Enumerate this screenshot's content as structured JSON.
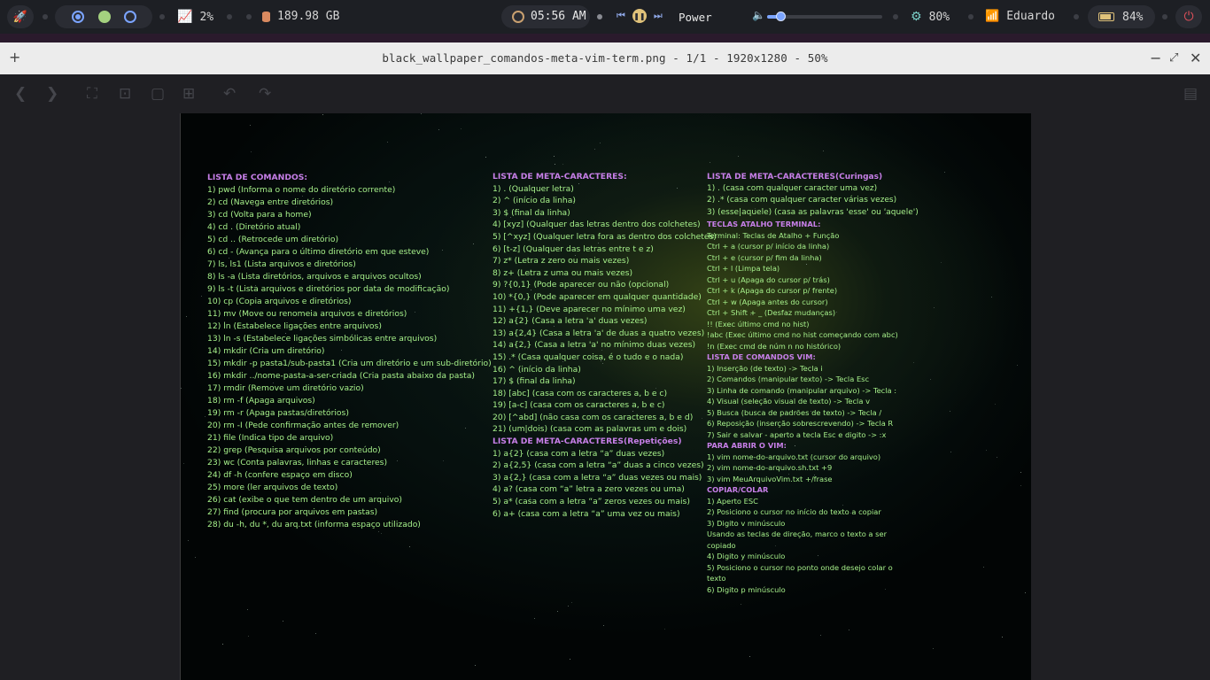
{
  "topbar": {
    "cpu": "2%",
    "disk": "189.98 GB",
    "time": "05:56 AM",
    "power_profile": "Power",
    "volume_level": 0.2,
    "brightness": "80%",
    "wifi": "Eduardo",
    "battery": "84%"
  },
  "window": {
    "title": "black_wallpaper_comandos-meta-vim-term.png - 1/1 - 1920x1280 - 50%",
    "add": "+",
    "minimize": "−",
    "restore": "⤢",
    "close": "✕"
  },
  "icons": {
    "launcher": "rocket-icon",
    "cpu": "chart-icon",
    "disk": "database-icon",
    "clock": "clock-icon",
    "volume": "speaker-icon",
    "brightness": "gear-icon",
    "wifi": "wifi-icon",
    "battery": "battery-icon",
    "power": "power-icon"
  },
  "colors": {
    "heading": "#c77fe8",
    "text": "#a6f08a",
    "accent": "#7ba4ff",
    "power": "#e0505a"
  },
  "wallpaper": {
    "col1": {
      "heading": "LISTA DE COMANDOS:",
      "lines": [
        "1) pwd (Informa o nome do diretório corrente)",
        "2) cd (Navega entre diretórios)",
        "3) cd (Volta para a home)",
        "4) cd . (Diretório atual)",
        "5) cd .. (Retrocede um diretório)",
        "6) cd - (Avança para o último diretório em que esteve)",
        "7) ls, ls1 (Lista arquivos e diretórios)",
        "8) ls -a (Lista diretórios, arquivos e arquivos ocultos)",
        "9) ls -t (Lista arquivos e diretórios por data de modificação)",
        "10) cp (Copia arquivos e diretórios)",
        "11) mv (Move ou renomeia arquivos e diretórios)",
        "12) ln (Estabelece ligações entre arquivos)",
        "13) ln -s (Estabelece ligações simbólicas entre arquivos)",
        "14) mkdir (Cria um diretório)",
        "15) mkdir -p pasta1/sub-pasta1 (Cria um diretório e um sub-diretório)",
        "16) mkdir ../nome-pasta-a-ser-criada (Cria pasta abaixo da pasta)",
        "17) rmdir (Remove um diretório vazio)",
        "18) rm -f (Apaga arquivos)",
        "19) rm -r (Apaga pastas/diretórios)",
        "20) rm -I (Pede confirmação antes de remover)",
        "21) file (Indica tipo de arquivo)",
        "22) grep (Pesquisa arquivos por conteúdo)",
        "23) wc (Conta palavras, linhas e caracteres)",
        "24) df -h (confere espaço em disco)",
        "25) more (ler arquivos de texto)",
        "26) cat (exibe o que tem dentro de um arquivo)",
        "27) find (procura por arquivos em pastas)",
        "28) du -h, du *, du arq.txt (informa espaço utilizado)"
      ]
    },
    "col2": {
      "heading": "LISTA DE META-CARACTERES:",
      "lines": [
        "1) . (Qualquer letra)",
        "2) ^ (início da linha)",
        "3) $ (final da linha)",
        "4) [xyz] (Qualquer das letras dentro dos colchetes)",
        "5) [^xyz] (Qualquer letra fora as dentro dos colchetes)",
        "6) [t-z] (Qualquer das letras entre t e z)",
        "7) z* (Letra z zero ou mais vezes)",
        "8) z+ (Letra z uma ou mais vezes)",
        "9) ?{0,1} (Pode aparecer ou não (opcional)",
        "10) *{0,} (Pode aparecer em qualquer quantidade)",
        "11) +{1,} (Deve aparecer no mínimo uma vez)",
        "12) a{2} (Casa a letra 'a' duas vezes)",
        "13) a{2,4} (Casa a letra 'a' de duas a quatro vezes)",
        "14) a{2,} (Casa a letra 'a' no mínimo duas vezes)",
        "15) .* (Casa qualquer coisa, é o tudo e o nada)",
        "16) ^ (início da linha)",
        "17) $ (final da linha)",
        "18) [abc] (casa com os caracteres a, b e c)",
        "19) [a-c] (casa com os caracteres a, b e c)",
        "20) [^abd] (não casa com os caracteres a, b e d)",
        "21) (um|dois) (casa com as palavras um e dois)"
      ],
      "heading2": "LISTA DE META-CARACTERES(Repetições)",
      "lines2": [
        "1) a{2} (casa com a letra “a” duas vezes)",
        "2) a{2,5} (casa com a letra “a” duas a cinco vezes)",
        "3) a{2,} (casa com a letra “a” duas vezes ou mais)",
        "4) a? (casa com “a” letra a zero vezes ou uma)",
        "5) a* (casa com a letra “a” zeros vezes ou mais)",
        "6) a+ (casa com a letra “a” uma vez ou mais)"
      ]
    },
    "col3": {
      "heading": "LISTA DE META-CARACTERES(Curingas)",
      "lines": [
        "1) . (casa com qualquer caracter uma vez)",
        "2) .* (casa com qualquer caracter várias vezes)",
        "3) (esse|aquele) (casa as palavras 'esse' ou 'aquele')"
      ],
      "heading2": "TECLAS ATALHO TERMINAL:",
      "lines2": [
        "Terminal: Teclas de Atalho + Função",
        "Ctrl + a (cursor p/ início da linha)",
        "Ctrl + e (cursor p/ fim da linha)",
        "Ctrl + l (Limpa tela)",
        "Ctrl + u (Apaga do cursor p/ trás)",
        "Ctrl + k (Apaga do cursor p/ frente)",
        "Ctrl + w (Apaga antes do cursor)",
        "Ctrl + Shift + _ (Desfaz mudanças)",
        "!! (Exec último cmd no hist)",
        "!abc (Exec último cmd no hist começando com abc)",
        "!n (Exec cmd de núm n no histórico)"
      ],
      "heading3": "LISTA DE COMANDOS VIM:",
      "lines3": [
        "1) Inserção (de texto) -> Tecla i",
        "2) Comandos (manipular texto) -> Tecla Esc",
        "3) Linha de comando (manipular arquivo) -> Tecla :",
        "4) Visual (seleção visual de texto) -> Tecla v",
        "5) Busca (busca de padrões de texto) -> Tecla /",
        "6) Reposição (inserção sobrescrevendo) -> Tecla R",
        "7) Sair e salvar - aperto a tecla Esc e digito -> :x"
      ],
      "heading4": "PARA ABRIR O VIM:",
      "lines4": [
        "1) vim nome-do-arquivo.txt (cursor do arquivo)",
        "2) vim nome-do-arquivo.sh.txt +9",
        "3) vim MeuArquivoVim.txt +/frase"
      ],
      "heading5": "COPIAR/COLAR",
      "lines5": [
        "1) Aperto ESC",
        "2) Posiciono o cursor no início do texto a copiar",
        "3) Digito v minúsculo",
        "Usando as teclas de direção, marco o texto a ser",
        "copiado",
        "4) Digito y minúsculo",
        "5) Posiciono o cursor no ponto onde desejo colar o",
        "texto",
        "6) Digito p minúsculo"
      ]
    }
  }
}
